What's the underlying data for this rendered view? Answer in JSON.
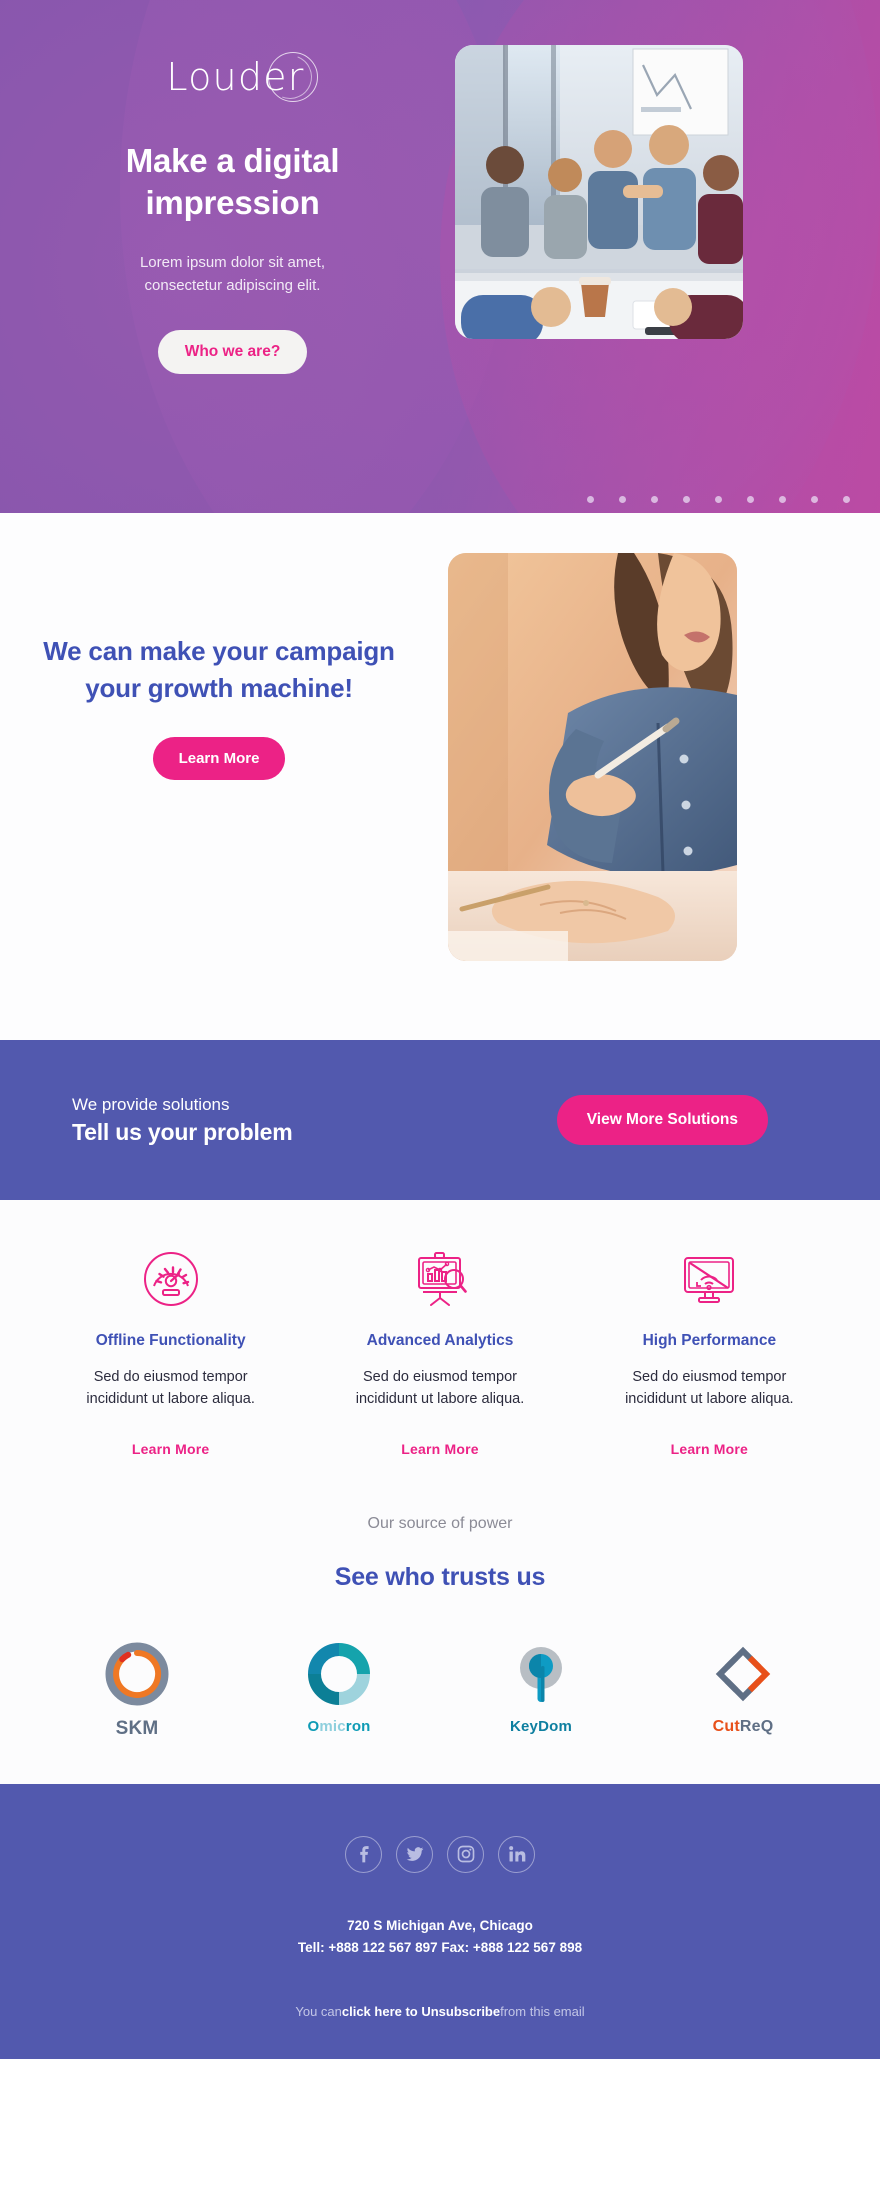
{
  "hero": {
    "logo": "Louder",
    "logo_icon": "circle-ring-logo-icon",
    "title_line1": "Make a digital",
    "title_line2": "impression",
    "subtitle_line1": "Lorem ipsum dolor sit amet,",
    "subtitle_line2": "consectetur adipiscing elit.",
    "cta_label": "Who we are?",
    "photo_alt": "team-meeting-photo",
    "carousel_dots": 9,
    "colors": {
      "gradient_start": "#5a5fb5",
      "gradient_end": "#b94ba4",
      "cta_text": "#ec2286",
      "cta_bg": "#f4f3f2"
    }
  },
  "section2": {
    "title_line1": "We can make your campaign",
    "title_line2": "your growth machine!",
    "cta_label": "Learn More",
    "photo_alt": "woman-pointing-at-screen-photo",
    "colors": {
      "title": "#3f51b5",
      "cta_bg": "#ec2286"
    }
  },
  "band": {
    "kicker": "We provide solutions",
    "headline": "Tell us your problem",
    "cta_label": "View More Solutions",
    "colors": {
      "bg": "#5259ae",
      "cta_bg": "#ec2286"
    }
  },
  "features": [
    {
      "icon": "speedometer-gauge-icon",
      "title": "Offline Functionality",
      "desc_line1": "Sed do eiusmod tempor",
      "desc_line2": "incididunt ut labore aliqua.",
      "link_label": "Learn More"
    },
    {
      "icon": "presentation-chart-magnifier-icon",
      "title": "Advanced Analytics",
      "desc_line1": "Sed do eiusmod tempor",
      "desc_line2": "incididunt ut labore aliqua.",
      "link_label": "Learn More"
    },
    {
      "icon": "monitor-wifi-slash-icon",
      "title": "High Performance",
      "desc_line1": "Sed do eiusmod tempor",
      "desc_line2": "incididunt ut labore aliqua.",
      "link_label": "Learn More"
    }
  ],
  "trust": {
    "kicker": "Our source of power",
    "title": "See who trusts us",
    "brands": [
      {
        "icon": "skm-double-ring-logo-icon",
        "name": "SKM",
        "colors": {
          "outer": "#7c8a9e",
          "inner": "#ef7824"
        }
      },
      {
        "icon": "omicron-segmented-donut-logo-icon",
        "name_accent": "O",
        "name_mid": "mic",
        "name_rest": "ron",
        "colors": {
          "teal": "#15a3ac",
          "blue": "#1287ad",
          "dark": "#0c7f96",
          "light": "#9ed3dd"
        }
      },
      {
        "icon": "keydom-key-in-circle-logo-icon",
        "name": "KeyDom",
        "colors": {
          "ring": "#b8bec4",
          "key": "#0e9bc4"
        }
      },
      {
        "icon": "cutreq-diamond-chevrons-logo-icon",
        "name_accent": "Cut",
        "name_rest": "ReQ",
        "colors": {
          "slate": "#5f6f85",
          "orange": "#e8501a"
        }
      }
    ]
  },
  "footer": {
    "social": [
      {
        "icon": "facebook-icon",
        "label": "Facebook"
      },
      {
        "icon": "twitter-icon",
        "label": "Twitter"
      },
      {
        "icon": "instagram-icon",
        "label": "Instagram"
      },
      {
        "icon": "linkedin-icon",
        "label": "LinkedIn"
      }
    ],
    "address": "720 S Michigan Ave, Chicago",
    "contact": "Tell: +888 122 567 897 Fax: +888 122 567 898",
    "unsub_pre": "You can",
    "unsub_link": "click here to Unsubscribe",
    "unsub_post": "from this email",
    "colors": {
      "bg": "#5259ae"
    }
  }
}
